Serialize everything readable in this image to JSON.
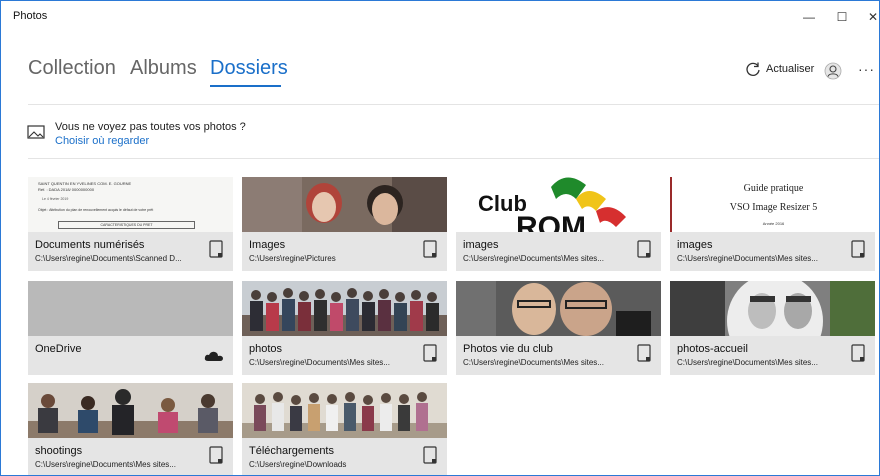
{
  "window": {
    "title": "Photos",
    "controls": [
      "—",
      "☐",
      "✕"
    ]
  },
  "nav": {
    "tabs": [
      {
        "label": "Collection",
        "active": false
      },
      {
        "label": "Albums",
        "active": false
      },
      {
        "label": "Dossiers",
        "active": true
      }
    ],
    "refresh_label": "Actualiser",
    "more_label": "···"
  },
  "notice": {
    "text": "Vous ne voyez pas toutes vos photos ?",
    "link": "Choisir où regarder"
  },
  "folders": [
    {
      "name": "Documents numérisés",
      "path": "C:\\Users\\regine\\Documents\\Scanned D...",
      "icon": "device-icon",
      "thumb_lines": [
        "SAINT QUENTIN EN YVELINES COM. E. GOURNE",
        "Réf. : DADA 2018/ 0000000000",
        "Le 4 février 2019",
        "Objet : Attribution du plan de renouvellement acquis le défaut de votre prêt",
        "CARACTERISTIQUES DU PRET"
      ]
    },
    {
      "name": "Images",
      "path": "C:\\Users\\regine\\Pictures",
      "icon": "device-icon"
    },
    {
      "name": "images",
      "path": "C:\\Users\\regine\\Documents\\Mes sites...",
      "icon": "device-icon",
      "thumb_lines": [
        "Club",
        "ROM"
      ]
    },
    {
      "name": "images",
      "path": "C:\\Users\\regine\\Documents\\Mes sites...",
      "icon": "device-icon",
      "thumb_lines": [
        "Guide pratique",
        "VSO Image Resizer 5",
        "Année 2016"
      ]
    },
    {
      "name": "OneDrive",
      "path": "",
      "icon": "cloud-icon"
    },
    {
      "name": "photos",
      "path": "C:\\Users\\regine\\Documents\\Mes sites...",
      "icon": "device-icon"
    },
    {
      "name": "Photos vie du club",
      "path": "C:\\Users\\regine\\Documents\\Mes sites...",
      "icon": "device-icon"
    },
    {
      "name": "photos-accueil",
      "path": "C:\\Users\\regine\\Documents\\Mes sites...",
      "icon": "device-icon"
    },
    {
      "name": "shootings",
      "path": "C:\\Users\\regine\\Documents\\Mes sites...",
      "icon": "device-icon"
    },
    {
      "name": "Téléchargements",
      "path": "C:\\Users\\regine\\Downloads",
      "icon": "device-icon"
    }
  ],
  "colors": {
    "accent": "#1a6fc9",
    "caption_bg": "#e5e5e5",
    "window_border": "#2b79d6"
  }
}
